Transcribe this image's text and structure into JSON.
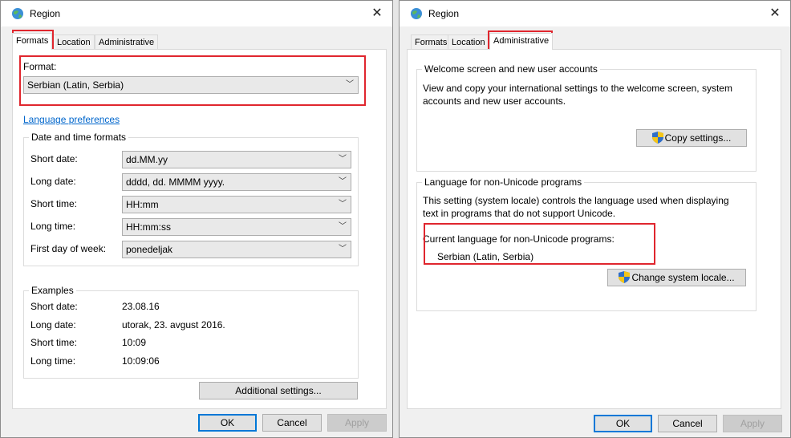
{
  "left": {
    "title": "Region",
    "tabs": [
      "Formats",
      "Location",
      "Administrative"
    ],
    "format_label": "Format:",
    "format_value": "Serbian (Latin, Serbia)",
    "language_link": "Language preferences",
    "datetime_group": "Date and time formats",
    "rows": [
      {
        "label": "Short date:",
        "value": "dd.MM.yy"
      },
      {
        "label": "Long date:",
        "value": "dddd, dd. MMMM yyyy."
      },
      {
        "label": "Short time:",
        "value": "HH:mm"
      },
      {
        "label": "Long time:",
        "value": "HH:mm:ss"
      },
      {
        "label": "First day of week:",
        "value": "ponedeljak"
      }
    ],
    "examples_group": "Examples",
    "examples": [
      {
        "label": "Short date:",
        "value": "23.08.16"
      },
      {
        "label": "Long date:",
        "value": "utorak, 23. avgust 2016."
      },
      {
        "label": "Short time:",
        "value": "10:09"
      },
      {
        "label": "Long time:",
        "value": "10:09:06"
      }
    ],
    "additional_button": "Additional settings...",
    "ok": "OK",
    "cancel": "Cancel",
    "apply": "Apply"
  },
  "right": {
    "title": "Region",
    "tabs": [
      "Formats",
      "Location",
      "Administrative"
    ],
    "welcome_group": "Welcome screen and new user accounts",
    "welcome_text_1": "View and copy your international settings to the welcome screen, system",
    "welcome_text_2": "accounts and new user accounts.",
    "copy_button": "Copy settings...",
    "nonunicode_group": "Language for non-Unicode programs",
    "nonunicode_text_1": "This setting (system locale) controls the language used when displaying",
    "nonunicode_text_2": "text in programs that do not support Unicode.",
    "current_label": "Current language for non-Unicode programs:",
    "current_value": "Serbian (Latin, Serbia)",
    "change_button": "Change system locale...",
    "ok": "OK",
    "cancel": "Cancel",
    "apply": "Apply"
  },
  "icons": {
    "globe": "globe-icon",
    "close": "close-icon",
    "shield": "uac-shield-icon",
    "chevron": "chevron-down-icon"
  },
  "colors": {
    "highlight": "#e0262e",
    "link": "#0066cc",
    "accent": "#0078d7"
  }
}
